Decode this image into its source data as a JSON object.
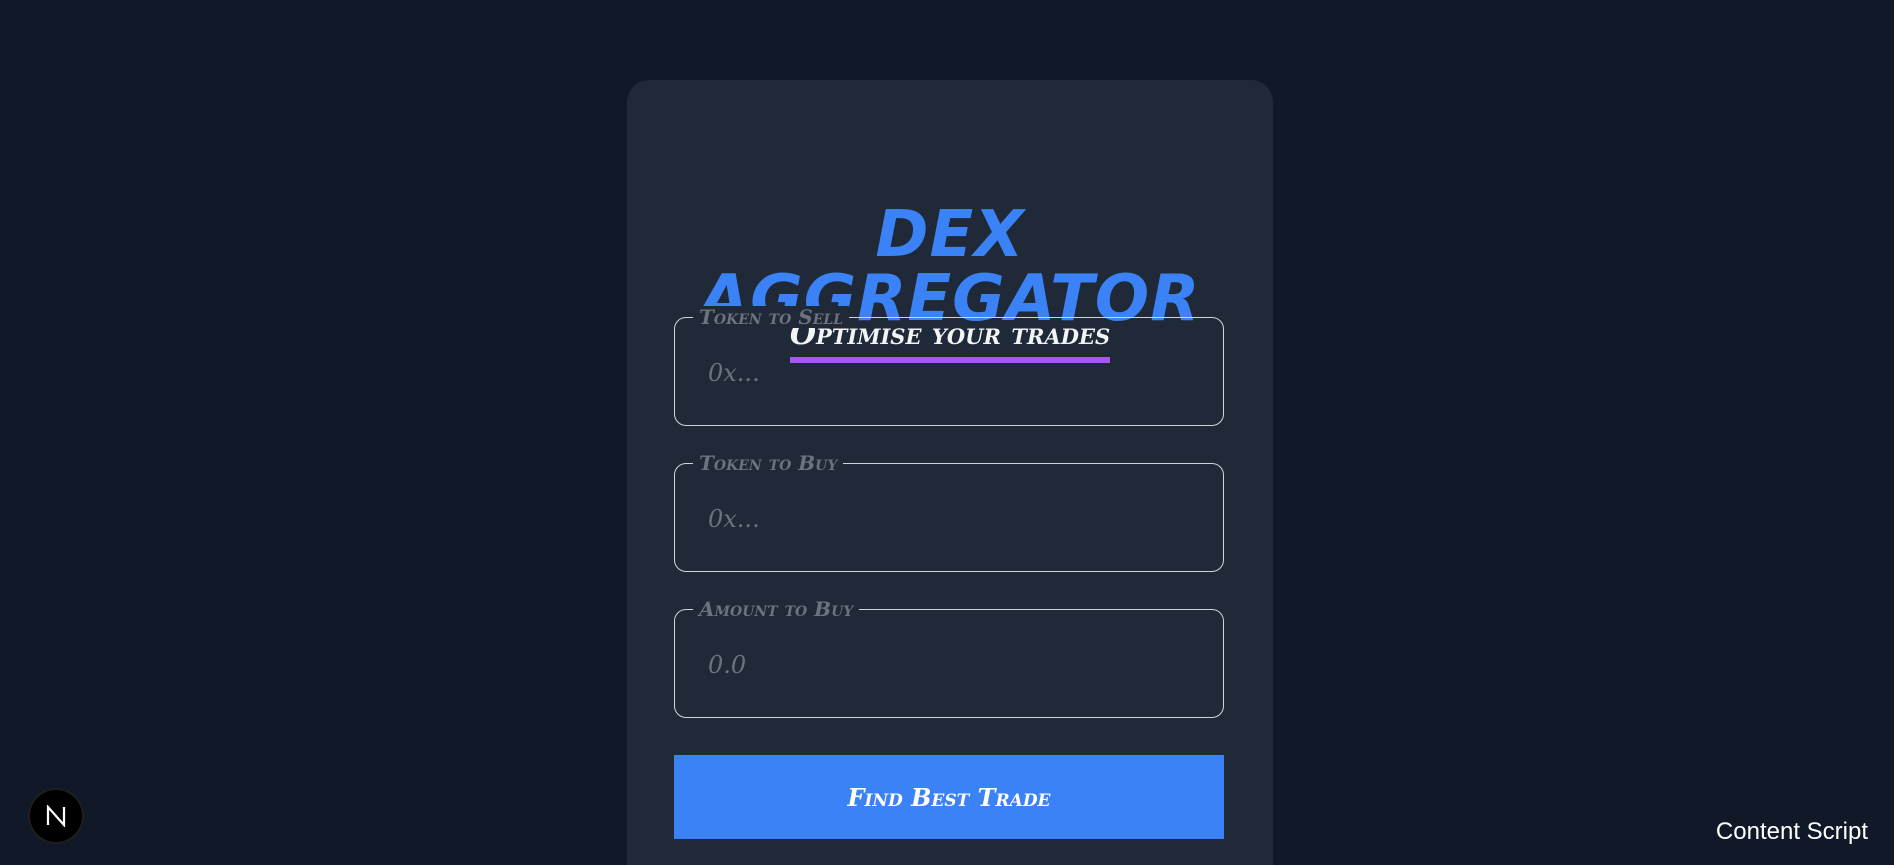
{
  "card": {
    "title": "DEX AGGREGATOR",
    "subtitle": "Optimise your trades"
  },
  "form": {
    "sell": {
      "label": "Token to Sell",
      "placeholder": "0x...",
      "value": ""
    },
    "buy": {
      "label": "Token to Buy",
      "placeholder": "0x...",
      "value": ""
    },
    "amount": {
      "label": "Amount to Buy",
      "placeholder": "0.0",
      "value": ""
    },
    "submit_label": "Find Best Trade"
  },
  "overlay": {
    "badge_letter": "N",
    "content_script_label": "Content Script"
  },
  "colors": {
    "background": "#111827",
    "card": "#1f2937",
    "accent_blue": "#3b82f6",
    "accent_purple": "#a855f7"
  },
  "icons": {
    "badge": "nextjs-n-icon"
  }
}
